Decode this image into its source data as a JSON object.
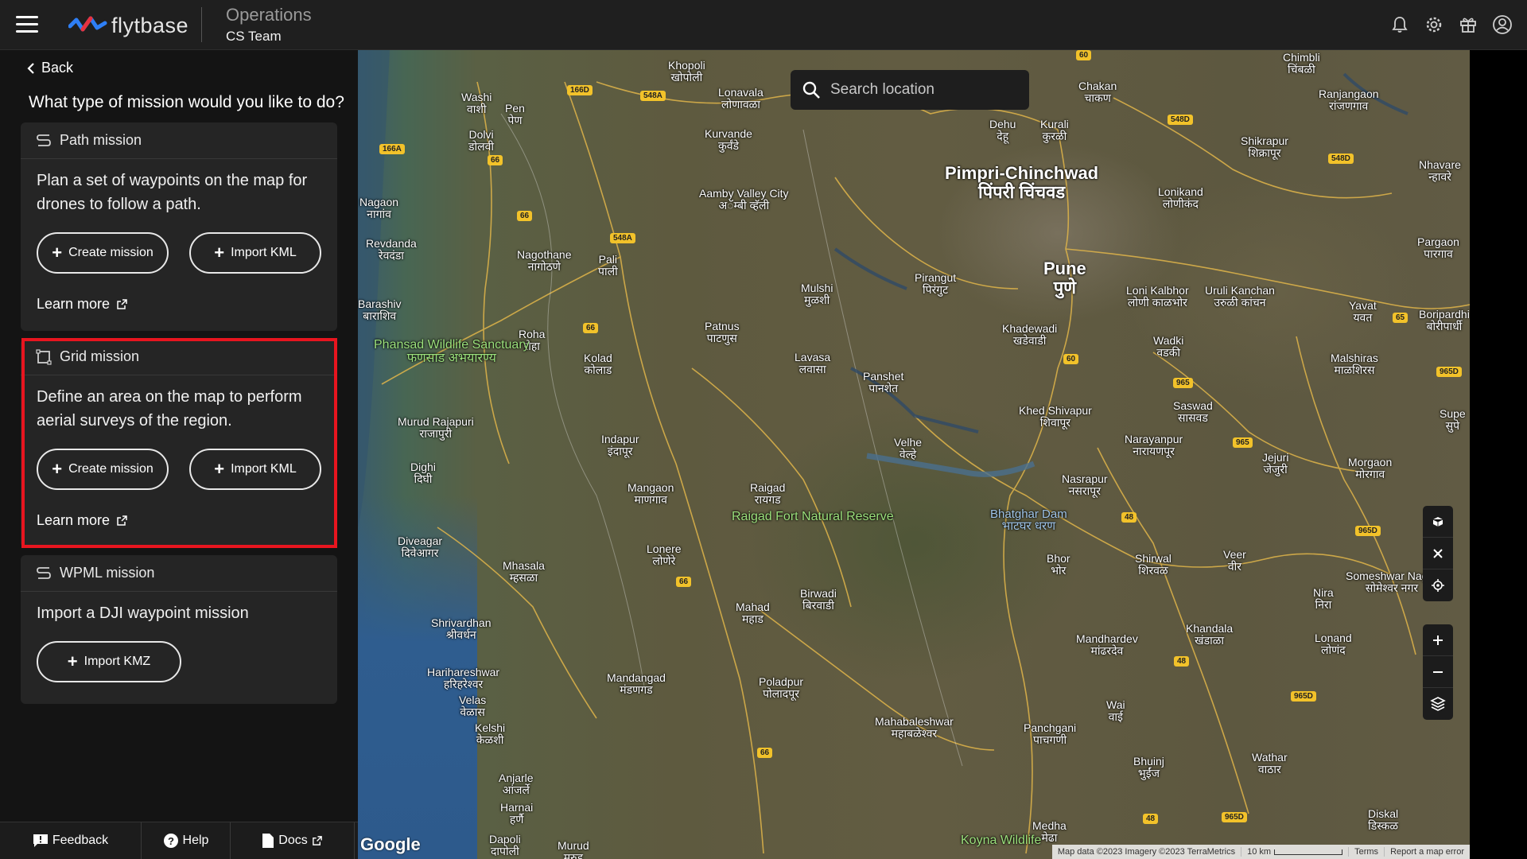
{
  "topbar": {
    "logo_text": "flytbase",
    "title": "Operations",
    "subtitle": "CS Team",
    "icons": [
      "bell-icon",
      "gear-icon",
      "gift-icon",
      "user-circle-icon"
    ]
  },
  "sidebar": {
    "back_label": "Back",
    "question": "What type of mission would you like to do?",
    "cards": [
      {
        "title": "Path mission",
        "description": "Plan a set of waypoints on the map for drones to follow a path.",
        "buttons": [
          "Create mission",
          "Import KML"
        ],
        "learn_more": "Learn more"
      },
      {
        "title": "Grid mission",
        "description": "Define an area on the map to perform aerial surveys of the region.",
        "buttons": [
          "Create mission",
          "Import KML"
        ],
        "learn_more": "Learn more",
        "highlighted": true
      },
      {
        "title": "WPML mission",
        "description": "Import a DJI waypoint mission",
        "buttons": [
          "Import KMZ"
        ]
      }
    ],
    "footer": {
      "feedback": "Feedback",
      "help": "Help",
      "docs": "Docs"
    },
    "highlight_color": "#e8151f"
  },
  "map": {
    "search_placeholder": "Search location",
    "places": [
      {
        "name": "Pimpri-Chinchwad",
        "local": "पिंपरी चिंचवड",
        "size": "big"
      },
      {
        "name": "Pune",
        "local": "पुणे",
        "size": "big"
      },
      {
        "name": "Khopoli",
        "local": "खोपोली"
      },
      {
        "name": "Lonavala",
        "local": "लोणावळा"
      },
      {
        "name": "Kurvande",
        "local": "कुर्वंडे"
      },
      {
        "name": "Aamby Valley City",
        "local": "अॅम्बी व्हॅली"
      },
      {
        "name": "Chakan",
        "local": "चाकण"
      },
      {
        "name": "Dehu",
        "local": "देहू"
      },
      {
        "name": "Kurali",
        "local": "कुरळी"
      },
      {
        "name": "Ranjangaon",
        "local": "रांजणगाव"
      },
      {
        "name": "Shikrapur",
        "local": "शिक्रापूर"
      },
      {
        "name": "Lonikand",
        "local": "लोणीकंद"
      },
      {
        "name": "Nhavare",
        "local": "न्हावरे"
      },
      {
        "name": "Pargaon",
        "local": "पारगाव"
      },
      {
        "name": "Washi",
        "local": "वाशी"
      },
      {
        "name": "Pen",
        "local": "पेण"
      },
      {
        "name": "Dolvi",
        "local": "डोलवी"
      },
      {
        "name": "Nagaon",
        "local": "नागांव"
      },
      {
        "name": "Revdanda",
        "local": "रेवदंडा"
      },
      {
        "name": "Nagothane",
        "local": "नागोठणे"
      },
      {
        "name": "Pali",
        "local": "पाली"
      },
      {
        "name": "Barashiv",
        "local": "बाराशिव"
      },
      {
        "name": "Roha",
        "local": "रोहा"
      },
      {
        "name": "Kolad",
        "local": "कोलाड"
      },
      {
        "name": "Patnus",
        "local": "पाटणुस"
      },
      {
        "name": "Mulshi",
        "local": "मुळशी"
      },
      {
        "name": "Pirangut",
        "local": "पिरंगुट"
      },
      {
        "name": "Loni Kalbhor",
        "local": "लोणी काळभोर"
      },
      {
        "name": "Uruli Kanchan",
        "local": "उरुळी कांचन"
      },
      {
        "name": "Yavat",
        "local": "यवत"
      },
      {
        "name": "Boripardhi",
        "local": "बोरीपार्धी"
      },
      {
        "name": "Khadewadi",
        "local": "खडेवाडी"
      },
      {
        "name": "Wadki",
        "local": "वडकी"
      },
      {
        "name": "Malshiras",
        "local": "माळशिरस"
      },
      {
        "name": "Lavasa",
        "local": "लवासा"
      },
      {
        "name": "Panshet",
        "local": "पानशेत"
      },
      {
        "name": "Phansad Wildlife Sanctuary",
        "local": "फणसाड अभयारण्य",
        "style": "green"
      },
      {
        "name": "Murud Rajapuri",
        "local": "राजापुरी"
      },
      {
        "name": "Indapur",
        "local": "इंदापूर"
      },
      {
        "name": "Velhe",
        "local": "वेल्हे"
      },
      {
        "name": "Khed Shivapur",
        "local": "शिवापूर"
      },
      {
        "name": "Saswad",
        "local": "सासवड"
      },
      {
        "name": "Narayanpur",
        "local": "नारायणपूर"
      },
      {
        "name": "Jejuri",
        "local": "जेजुरी"
      },
      {
        "name": "Supe",
        "local": "सुपे"
      },
      {
        "name": "Morgaon",
        "local": "मोरगाव"
      },
      {
        "name": "Dighi",
        "local": "दिघी"
      },
      {
        "name": "Mangaon",
        "local": "माणगाव"
      },
      {
        "name": "Raigad",
        "local": "रायगड"
      },
      {
        "name": "Raigad Fort Natural Reserve",
        "style": "green"
      },
      {
        "name": "Nasrapur",
        "local": "नसरापूर"
      },
      {
        "name": "Bhatghar Dam",
        "local": "भाटघर धरण",
        "style": "blue"
      },
      {
        "name": "Diveagar",
        "local": "दिवेआगर"
      },
      {
        "name": "Mhasala",
        "local": "म्हसळा"
      },
      {
        "name": "Lonere",
        "local": "लोणेरे"
      },
      {
        "name": "Bhor",
        "local": "भोर"
      },
      {
        "name": "Shirwal",
        "local": "शिरवळ"
      },
      {
        "name": "Veer",
        "local": "वीर"
      },
      {
        "name": "Nira",
        "local": "निरा"
      },
      {
        "name": "Someshwar Nagar",
        "local": "सोमेश्वर नगर"
      },
      {
        "name": "Shrivardhan",
        "local": "श्रीवर्धन"
      },
      {
        "name": "Mahad",
        "local": "महाड"
      },
      {
        "name": "Birwadi",
        "local": "बिरवाडी"
      },
      {
        "name": "Mandhardev",
        "local": "मांढरदेव"
      },
      {
        "name": "Khandala",
        "local": "खंडाळा"
      },
      {
        "name": "Lonand",
        "local": "लोणंद"
      },
      {
        "name": "Harihareshwar",
        "local": "हरिहरेश्वर"
      },
      {
        "name": "Velas",
        "local": "वेळास"
      },
      {
        "name": "Mandangad",
        "local": "मंडणगड"
      },
      {
        "name": "Poladpur",
        "local": "पोलादपूर"
      },
      {
        "name": "Kelshi",
        "local": "केळशी"
      },
      {
        "name": "Mahabaleshwar",
        "local": "महाबळेश्वर"
      },
      {
        "name": "Panchgani",
        "local": "पाचगणी"
      },
      {
        "name": "Wai",
        "local": "वाई"
      },
      {
        "name": "Bhuinj",
        "local": "भुईंज"
      },
      {
        "name": "Wathar",
        "local": "वाठार"
      },
      {
        "name": "Anjarle",
        "local": "आंजर्ले"
      },
      {
        "name": "Harnai",
        "local": "हर्णै"
      },
      {
        "name": "Murud",
        "local": "मुरुड"
      },
      {
        "name": "Dapoli",
        "local": "दापोली"
      },
      {
        "name": "Medha",
        "local": "मेढा"
      },
      {
        "name": "Koyna Wildlife",
        "style": "green"
      },
      {
        "name": "Diskal",
        "local": "डिस्कळ"
      },
      {
        "name": "Murud",
        "local": "मुरुड"
      },
      {
        "name": "Chimbli",
        "local": "चिंबळी"
      }
    ],
    "road_shields": [
      "166D",
      "548A",
      "60",
      "548D",
      "548D",
      "548D",
      "166A",
      "66",
      "66",
      "548A",
      "66",
      "60",
      "965",
      "65",
      "965D",
      "965",
      "48",
      "965D",
      "66",
      "48",
      "965D",
      "66",
      "48",
      "965D"
    ],
    "controls": [
      "cube-icon",
      "crosshair-x-icon",
      "locate-icon",
      "zoom-in-icon",
      "zoom-out-icon",
      "layers-icon"
    ],
    "google_logo": "Google",
    "attribution": {
      "map_data": "Map data ©2023 Imagery ©2023 TerraMetrics",
      "scale": "10 km",
      "terms": "Terms",
      "report": "Report a map error"
    }
  }
}
